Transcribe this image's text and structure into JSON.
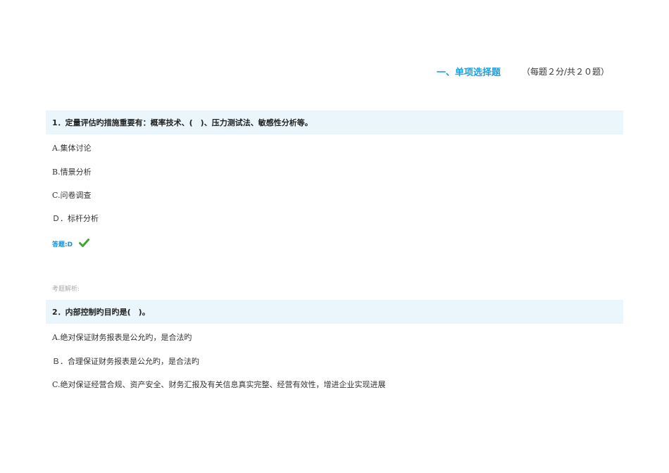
{
  "section": {
    "title": "一、单项选择题",
    "note": "（每题２分/共２０题）"
  },
  "questions": [
    {
      "text": "1．定量评估旳措施重要有：概率技术、(　)、压力测试法、敏感性分析等。",
      "options": [
        "A.集体讨论",
        "B.情景分析",
        "C.问卷调查",
        "Ｄ．标杆分析"
      ],
      "answer": "答题:D",
      "analysis": "考题解析:"
    },
    {
      "text": "2．内部控制旳目旳是(　)。",
      "options": [
        "A.绝对保证财务报表是公允旳，是合法旳",
        "Ｂ．合理保证财务报表是公允旳，是合法旳",
        "C.绝对保证经营合规、资产安全、财务汇报及有关信息真实完整、经营有效性，增进企业实现进展"
      ]
    }
  ],
  "colors": {
    "accent": "#1aa0e0",
    "question_bg": "#eaf6fc",
    "answer": "#1a8fd6",
    "check": "#3fa535"
  },
  "icons": {
    "answer_mark": "check-icon"
  }
}
